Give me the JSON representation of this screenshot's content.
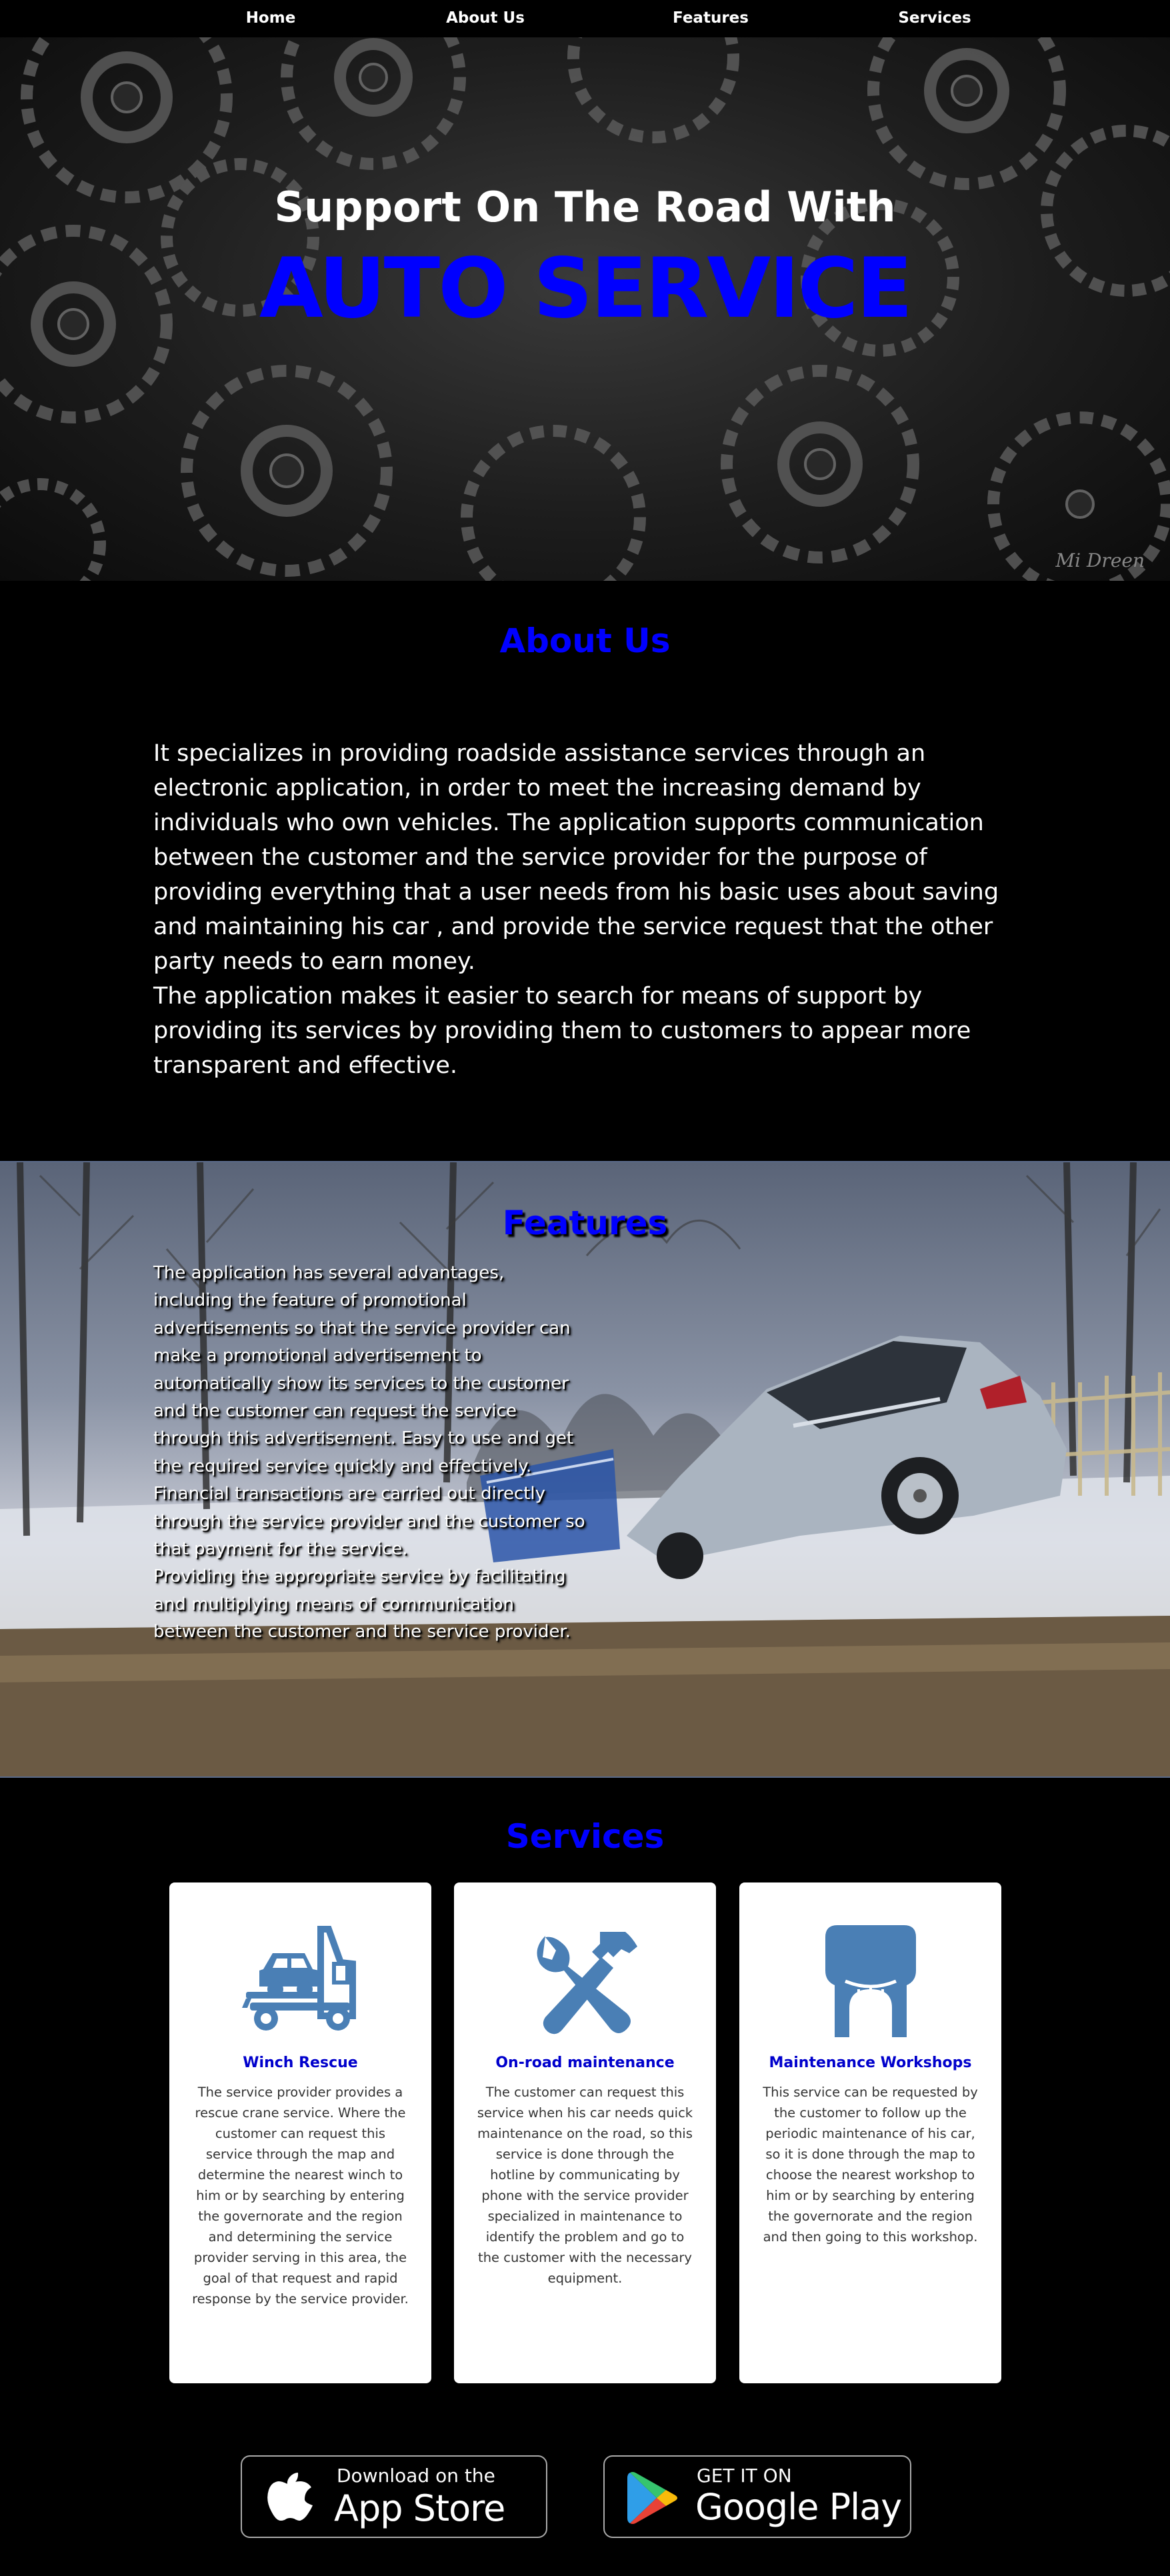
{
  "nav": {
    "items": [
      {
        "label": "Home"
      },
      {
        "label": "About Us"
      },
      {
        "label": "Features"
      },
      {
        "label": "Services"
      }
    ]
  },
  "hero": {
    "subtitle": "Support On The Road With",
    "title": "AUTO SERVICE",
    "signature": "Mi Dreen"
  },
  "about": {
    "title": "About Us",
    "paragraph_1": "It specializes in providing roadside assistance services through an electronic application, in order to meet the increasing demand by individuals who own vehicles. The application supports communication between the customer and the service provider for the purpose of providing everything that a user needs from his basic uses about saving and maintaining his car , and provide the service request that the other party needs to earn money.",
    "paragraph_2": "The application makes it easier to search for means of support by providing its services by providing them to customers to appear more transparent and effective."
  },
  "features": {
    "title": "Features",
    "paragraph_1": "The application has several advantages, including the feature of promotional advertisements so that the service provider can make a promotional advertisement to automatically show its services to the customer and the customer can request the service through this advertisement. Easy to use and get the required service quickly and effectively.",
    "paragraph_2": "Financial transactions are carried out directly through the service provider and the customer so that payment for the service.",
    "paragraph_3": "Providing the appropriate service by facilitating and multiplying means of communication between the customer and the service provider."
  },
  "services": {
    "title": "Services",
    "icon_color": "#4a7fb5",
    "cards": [
      {
        "icon": "tow-truck-icon",
        "title": "Winch Rescue",
        "text": "The service provider provides a rescue crane service. Where the customer can request this service through the map and determine the nearest winch to him or by searching by entering the governorate and the region and determining the service provider serving in this area, the goal of that request and rapid response by the service provider."
      },
      {
        "icon": "wrench-hammer-icon",
        "title": "On-road maintenance",
        "text": "The customer can request this service when his car needs quick maintenance on the road, so this service is done through the hotline by communicating by phone with the service provider specialized in maintenance to identify the problem and go to the customer with the necessary equipment."
      },
      {
        "icon": "workshop-icon",
        "title": "Maintenance Workshops",
        "text": "This service can be requested by the customer to follow up the periodic maintenance of his car, so it is done through the map to choose the nearest workshop to him or by searching by entering the governorate and the region and then going to this workshop."
      }
    ]
  },
  "stores": {
    "app_store": {
      "small": "Download on the",
      "big": "App Store"
    },
    "google_play": {
      "small": "GET IT ON",
      "big": "Google Play"
    }
  }
}
